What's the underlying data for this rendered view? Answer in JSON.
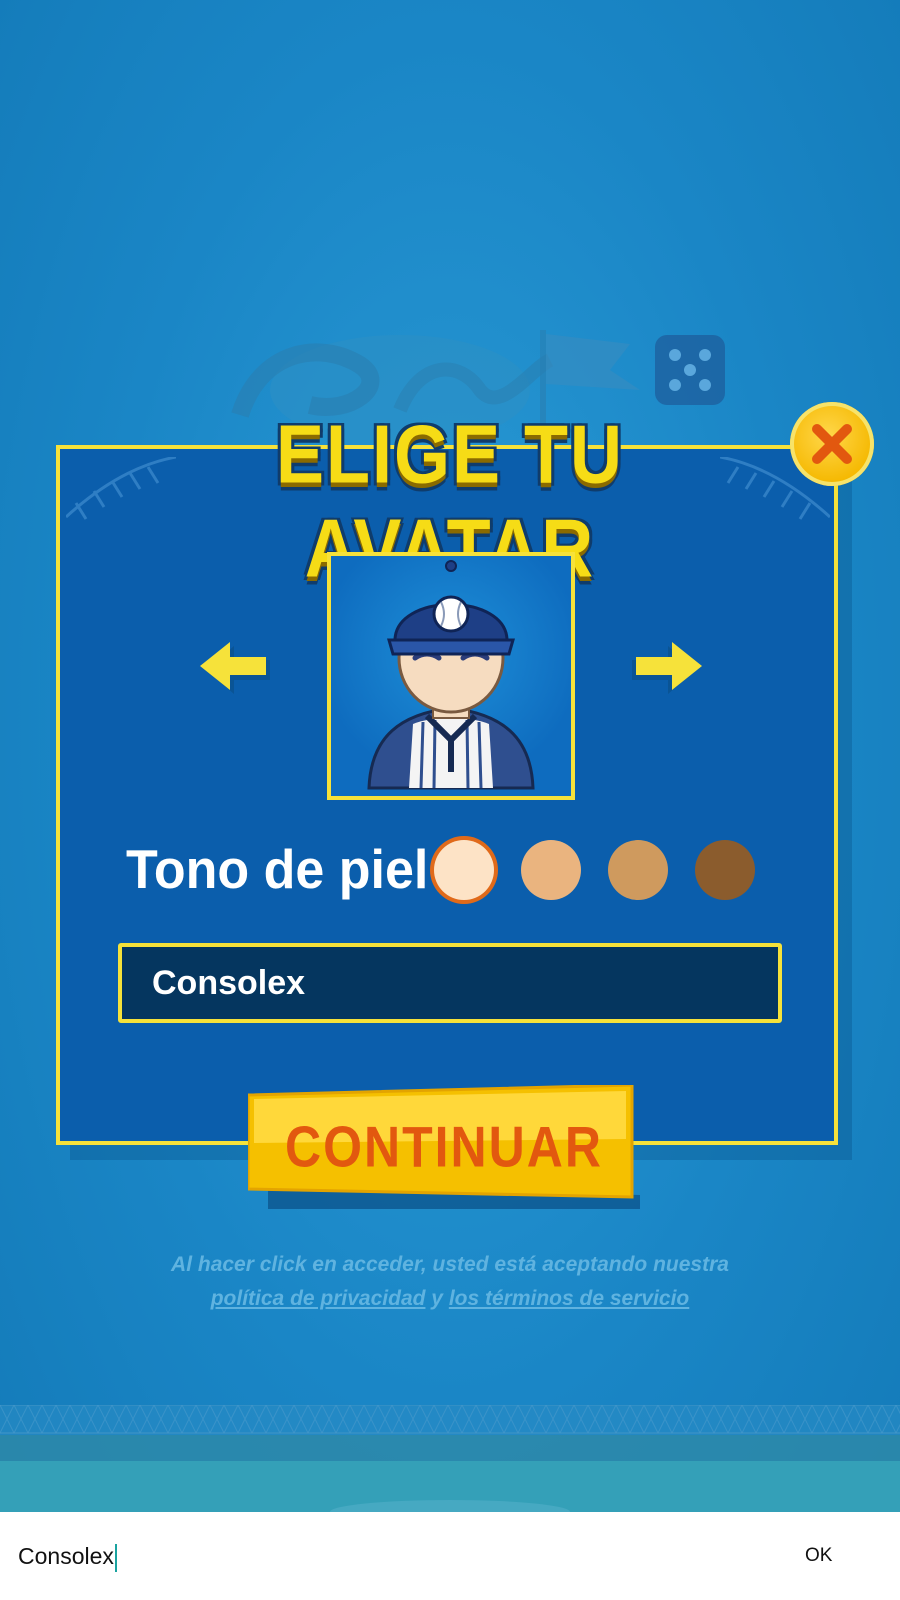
{
  "dialog": {
    "title": "ELIGE TU AVATAR",
    "skin_tone_label": "Tono de piel",
    "skin_tones": [
      "#fde3c6",
      "#eab47f",
      "#cf9a5e",
      "#8b5c2d"
    ],
    "selected_skin_tone_index": 0,
    "name_value": "Consolex",
    "continue_label": "CONTINUAR"
  },
  "terms": {
    "line1": "Al hacer click en acceder, usted está aceptando nuestra",
    "privacy_link": "política de privacidad",
    "conjunction": "y",
    "terms_link": "los términos de servicio"
  },
  "keyboard": {
    "input_value": "Consolex",
    "ok_label": "OK"
  },
  "icons": {
    "close": "close-icon",
    "prev": "arrow-left-icon",
    "next": "arrow-right-icon"
  },
  "colors": {
    "background": "#1a86c6",
    "panel": "#0b5eac",
    "accent_yellow": "#f6e23a",
    "button_text": "#e2580f"
  }
}
